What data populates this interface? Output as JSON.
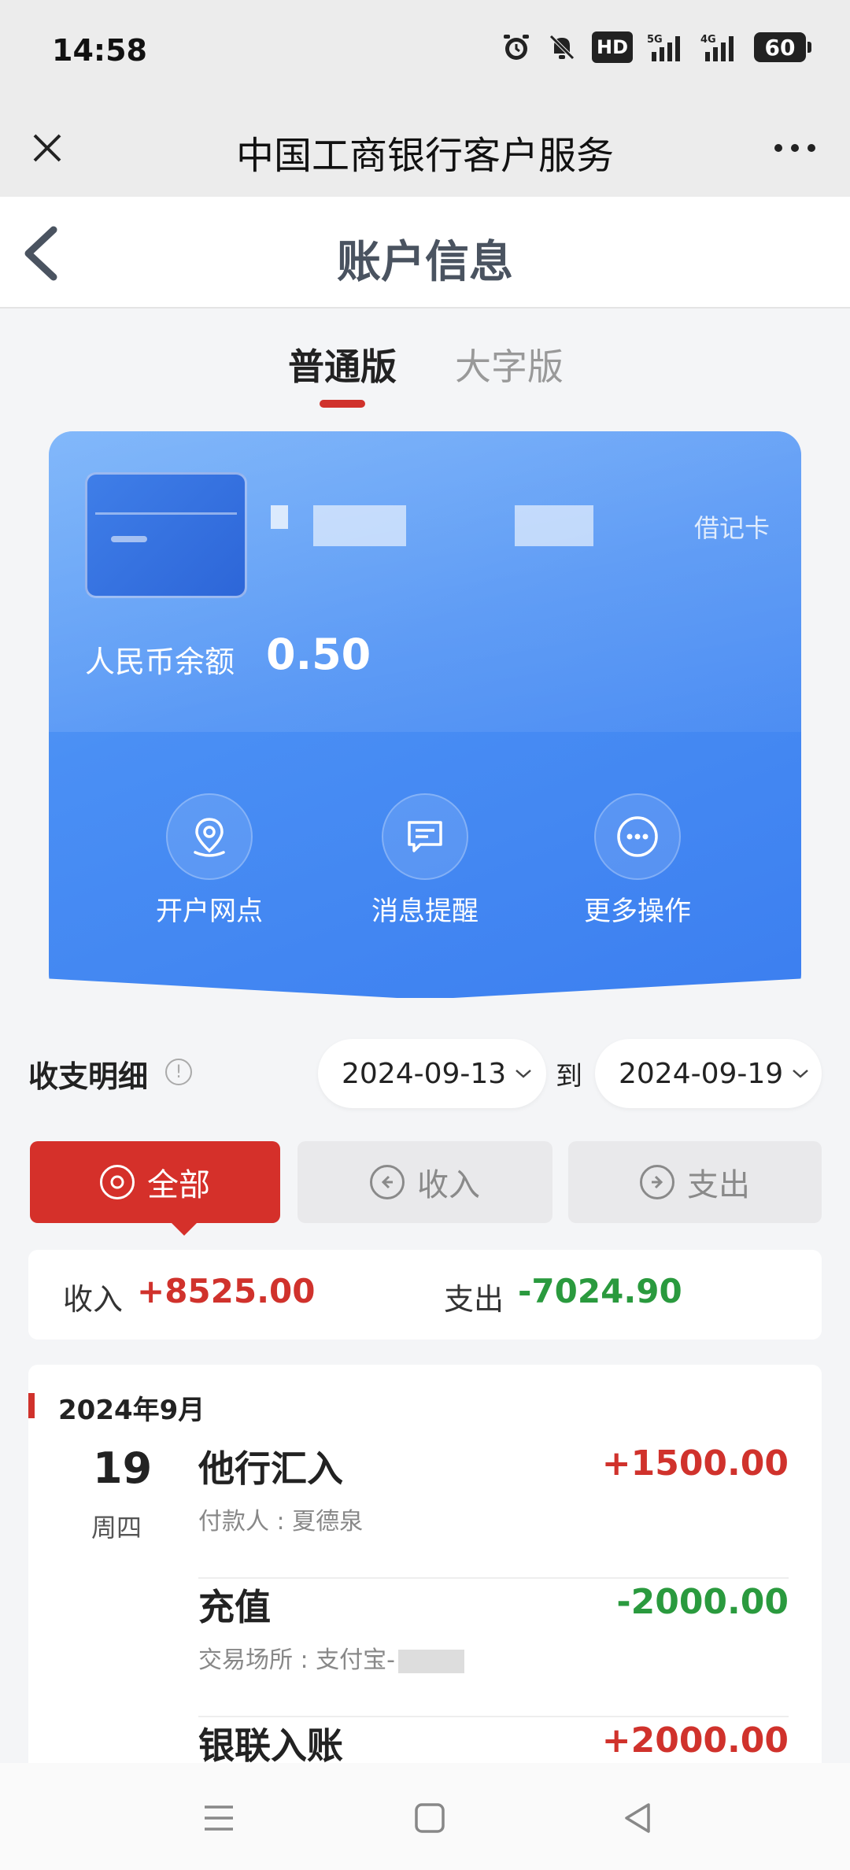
{
  "status_bar": {
    "time": "14:58",
    "battery": "60",
    "hd_label": "HD",
    "network_1": "5G",
    "network_2": "4G"
  },
  "title_bar": {
    "title": "中国工商银行客户服务"
  },
  "page_header": {
    "title": "账户信息"
  },
  "tabs": [
    {
      "label": "普通版",
      "active": true
    },
    {
      "label": "大字版",
      "active": false
    }
  ],
  "card": {
    "type": "借记卡",
    "balance_label": "人民币余额",
    "balance_value": "0.50",
    "actions": [
      {
        "label": "开户网点",
        "icon": "location-icon"
      },
      {
        "label": "消息提醒",
        "icon": "message-icon"
      },
      {
        "label": "更多操作",
        "icon": "more-ops-icon"
      }
    ]
  },
  "details": {
    "title": "收支明细",
    "date_from": "2024-09-13",
    "date_sep": "到",
    "date_to": "2024-09-19",
    "filters": [
      {
        "label": "全部",
        "active": true
      },
      {
        "label": "收入",
        "active": false
      },
      {
        "label": "支出",
        "active": false
      }
    ],
    "summary": {
      "income_label": "收入",
      "income_value": "+8525.00",
      "expense_label": "支出",
      "expense_value": "-7024.90"
    },
    "month": "2024年9月",
    "day": "19",
    "weekday": "周四",
    "transactions": [
      {
        "name": "他行汇入",
        "sub": "付款人 : 夏德泉",
        "amount": "+1500.00"
      },
      {
        "name": "充值",
        "sub": "交易场所 : 支付宝-",
        "amount": "-2000.00"
      },
      {
        "name": "银联入账",
        "sub": "",
        "amount": "+2000.00"
      }
    ]
  },
  "colors": {
    "accent_red": "#d0322c",
    "income_red": "#d0322c",
    "expense_green": "#2a9a3e",
    "card_blue": "#4a8ff4"
  }
}
